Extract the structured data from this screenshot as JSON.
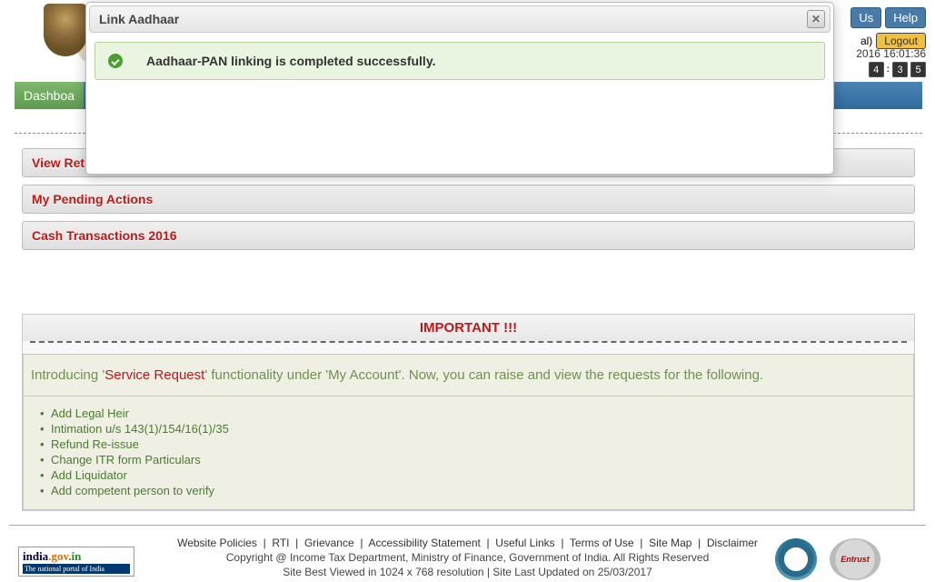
{
  "header": {
    "buttons": {
      "us": "Us",
      "help": "Help"
    },
    "logout_prefix": "al)",
    "logout": "Logout",
    "clock": "2016 16:01:36",
    "counter": [
      "4",
      "3",
      "5"
    ]
  },
  "nav": {
    "dashboard": "Dashboa"
  },
  "sections": {
    "view_returns": "View Returns / Forms",
    "pending": "My Pending Actions",
    "cash": "Cash Transactions 2016"
  },
  "important": {
    "title": "IMPORTANT !!!",
    "intro_pre": "Introducing '",
    "intro_sr": "Service Request",
    "intro_mid": "' functionality under '",
    "intro_acc": "My Account",
    "intro_post": "'. Now, you can raise and view the requests for the following.",
    "items": [
      "Add Legal Heir",
      "Intimation u/s 143(1)/154/16(1)/35",
      "Refund Re-issue",
      "Change ITR form Particulars",
      "Add Liquidator",
      "Add competent person to verify"
    ]
  },
  "footer": {
    "links": [
      "Website Policies",
      "RTI",
      "Grievance",
      "Accessibility Statement",
      "Useful Links",
      "Terms of Use",
      "Site Map",
      "Disclaimer"
    ],
    "copyright": "Copyright @ Income Tax Department, Ministry of Finance, Government of India. All Rights Reserved",
    "bestview": "Site Best Viewed in 1024 x 768 resolution | Site Last Updated on 25/03/2017",
    "india_t1a": "india",
    "india_t1b": ".gov",
    "india_t1c": ".in",
    "india_t2": "The national portal of India",
    "entrust": "Entrust"
  },
  "modal": {
    "title": "Link Aadhaar",
    "message": "Aadhaar-PAN linking is completed successfully.",
    "close": "✕"
  }
}
